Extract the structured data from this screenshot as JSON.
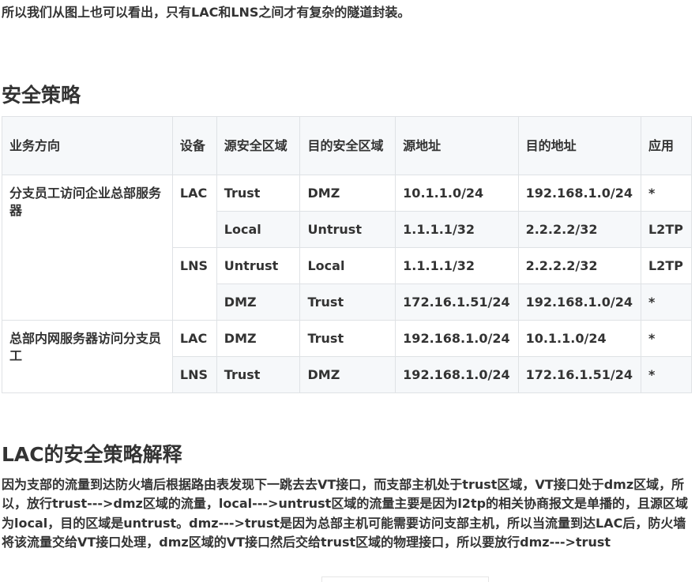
{
  "intro_text": "所以我们从图上也可以看出，只有LAC和LNS之间才有复杂的隧道封装。",
  "section_policy_title": "安全策略",
  "table": {
    "headers": [
      "业务方向",
      "设备",
      "源安全区域",
      "目的安全区域",
      "源地址",
      "目的地址",
      "应用"
    ],
    "groups": [
      {
        "direction": "分支员工访问企业总部服务器",
        "devices": [
          {
            "device": "LAC",
            "rules": [
              {
                "src_zone": "Trust",
                "dst_zone": "DMZ",
                "src_addr": "10.1.1.0/24",
                "dst_addr": "192.168.1.0/24",
                "app": "*"
              },
              {
                "src_zone": "Local",
                "dst_zone": "Untrust",
                "src_addr": "1.1.1.1/32",
                "dst_addr": "2.2.2.2/32",
                "app": "L2TP"
              }
            ]
          },
          {
            "device": "LNS",
            "rules": [
              {
                "src_zone": "Untrust",
                "dst_zone": "Local",
                "src_addr": "1.1.1.1/32",
                "dst_addr": "2.2.2.2/32",
                "app": "L2TP"
              },
              {
                "src_zone": "DMZ",
                "dst_zone": "Trust",
                "src_addr": "172.16.1.51/24",
                "dst_addr": "192.168.1.0/24",
                "app": "*"
              }
            ]
          }
        ]
      },
      {
        "direction": "总部内网服务器访问分支员工",
        "devices": [
          {
            "device": "LAC",
            "rules": [
              {
                "src_zone": "DMZ",
                "dst_zone": "Trust",
                "src_addr": "192.168.1.0/24",
                "dst_addr": "10.1.1.0/24",
                "app": "*"
              }
            ]
          },
          {
            "device": "LNS",
            "rules": [
              {
                "src_zone": "Trust",
                "dst_zone": "DMZ",
                "src_addr": "192.168.1.0/24",
                "dst_addr": "172.16.1.51/24",
                "app": "*"
              }
            ]
          }
        ]
      }
    ]
  },
  "section_lac_title": "LAC的安全策略解释",
  "lac_paragraph": "因为支部的流量到达防火墙后根据路由表发现下一跳去去VT接口，而支部主机处于trust区域，VT接口处于dmz区域，所以，放行trust--->dmz区域的流量，local--->untrust区域的流量主要是因为l2tp的相关协商报文是单播的，且源区域为local，目的区域是untrust。dmz--->trust是因为总部主机可能需要访问支部主机，所以当流量到达LAC后，防火墙将该流量交给VT接口处理，dmz区域的VT接口然后交给trust区域的物理接口，所以要放行dmz--->trust",
  "colors": {
    "text": "#333333",
    "table_border": "#dfe2e5",
    "header_bg": "#f6f8fa",
    "stripe_bg": "#f6f8fa"
  }
}
